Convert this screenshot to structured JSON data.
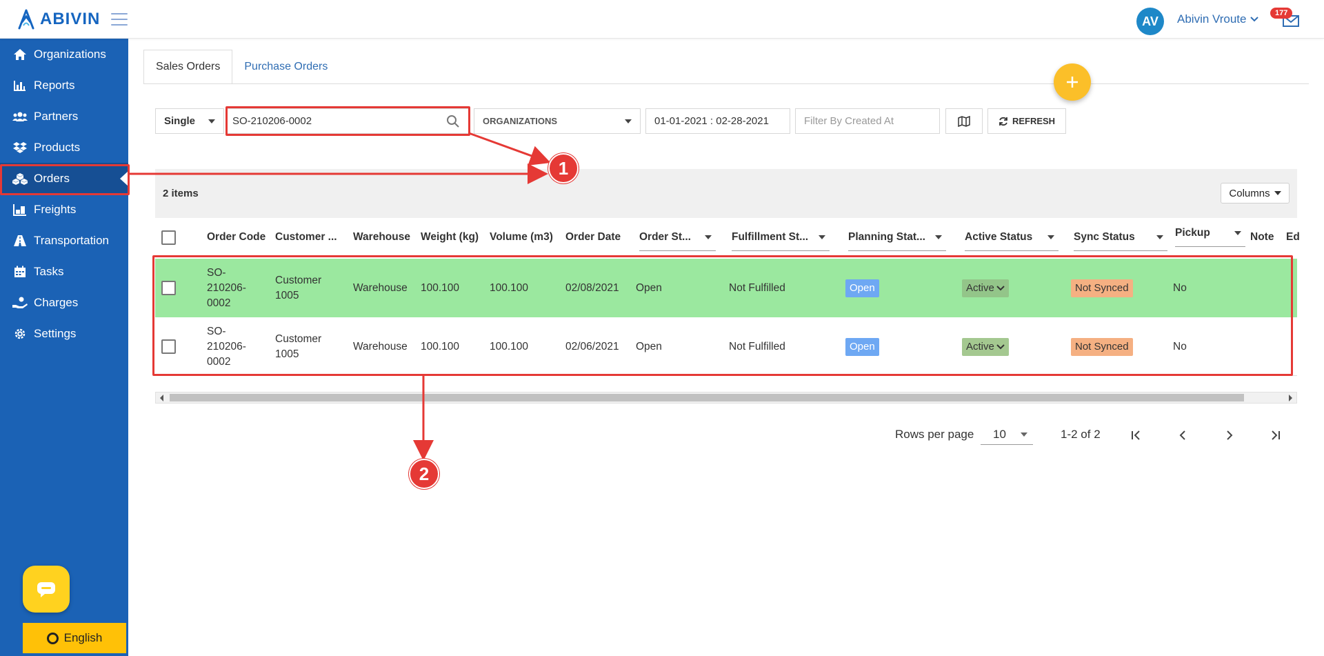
{
  "header": {
    "brand": "ABIVIN",
    "avatar_initials": "AV",
    "user_name": "Abivin Vroute",
    "notification_count": "177"
  },
  "sidebar": {
    "items": [
      {
        "label": "Organizations",
        "icon": "home-icon"
      },
      {
        "label": "Reports",
        "icon": "bar-chart-icon"
      },
      {
        "label": "Partners",
        "icon": "users-icon"
      },
      {
        "label": "Products",
        "icon": "dropbox-icon"
      },
      {
        "label": "Orders",
        "icon": "cubes-icon",
        "active": true
      },
      {
        "label": "Freights",
        "icon": "pallet-icon"
      },
      {
        "label": "Transportation",
        "icon": "road-icon"
      },
      {
        "label": "Tasks",
        "icon": "calendar-icon"
      },
      {
        "label": "Charges",
        "icon": "hand-coin-icon"
      },
      {
        "label": "Settings",
        "icon": "gear-icon"
      }
    ],
    "language": "English"
  },
  "tabs": [
    "Sales Orders",
    "Purchase Orders"
  ],
  "filters": {
    "mode": "Single",
    "search_value": "SO-210206-0002",
    "organizations": "ORGANIZATIONS",
    "date_range": "01-01-2021 : 02-28-2021",
    "created_at_placeholder": "Filter By Created At",
    "refresh_label": "REFRESH"
  },
  "table": {
    "items_count": "2 items",
    "columns_button": "Columns",
    "headers": [
      "Order Code",
      "Customer ...",
      "Warehouse",
      "Weight (kg)",
      "Volume (m3)",
      "Order Date",
      "Order St...",
      "Fulfillment St...",
      "Planning Stat...",
      "Active Status",
      "Sync Status",
      "Pickup",
      "Note",
      "Ed"
    ],
    "rows": [
      {
        "order_code": [
          "SO-",
          "210206-",
          "0002"
        ],
        "customer": [
          "Customer",
          "1005"
        ],
        "warehouse": "Warehouse",
        "weight": "100.100",
        "volume": "100.100",
        "order_date": "02/08/2021",
        "order_status": "Open",
        "fulfillment": "Not Fulfilled",
        "planning": "Open",
        "active": "Active",
        "sync": "Not Synced",
        "pickup": "No"
      },
      {
        "order_code": [
          "SO-",
          "210206-",
          "0002"
        ],
        "customer": [
          "Customer",
          "1005"
        ],
        "warehouse": "Warehouse",
        "weight": "100.100",
        "volume": "100.100",
        "order_date": "02/06/2021",
        "order_status": "Open",
        "fulfillment": "Not Fulfilled",
        "planning": "Open",
        "active": "Active",
        "sync": "Not Synced",
        "pickup": "No"
      }
    ]
  },
  "pagination": {
    "rows_per_page_label": "Rows per page",
    "rows_per_page_value": "10",
    "range": "1-2 of 2"
  },
  "annotations": [
    "1",
    "2"
  ],
  "colors": {
    "sidebar": "#1b62b5",
    "accent": "#2f6db3",
    "highlight": "#e53935",
    "row_highlight": "#9be89f",
    "fab": "#fbbf29"
  }
}
